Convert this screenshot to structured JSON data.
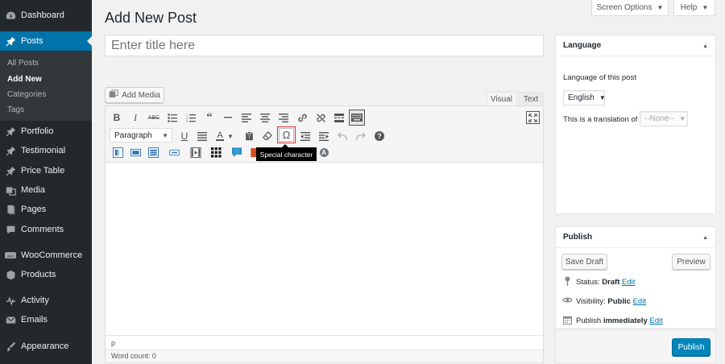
{
  "sidebar": {
    "items": [
      {
        "label": "Dashboard",
        "icon": "dashboard-icon"
      },
      {
        "label": "Posts",
        "icon": "pin-icon",
        "active": true
      },
      {
        "label": "Portfolio",
        "icon": "pin-icon"
      },
      {
        "label": "Testimonial",
        "icon": "pin-icon"
      },
      {
        "label": "Price Table",
        "icon": "pin-icon"
      },
      {
        "label": "Media",
        "icon": "media-icon"
      },
      {
        "label": "Pages",
        "icon": "pages-icon"
      },
      {
        "label": "Comments",
        "icon": "comments-icon"
      },
      {
        "label": "WooCommerce",
        "icon": "woocommerce-icon"
      },
      {
        "label": "Products",
        "icon": "products-icon"
      },
      {
        "label": "Activity",
        "icon": "activity-icon"
      },
      {
        "label": "Emails",
        "icon": "emails-icon"
      },
      {
        "label": "Appearance",
        "icon": "appearance-icon"
      }
    ],
    "submenu": [
      "All Posts",
      "Add New",
      "Categories",
      "Tags"
    ],
    "submenu_current": "Add New"
  },
  "header": {
    "screen_options": "Screen Options",
    "help": "Help",
    "title": "Add New Post"
  },
  "title_field": {
    "placeholder": "Enter title here",
    "value": ""
  },
  "editor": {
    "add_media": "Add Media",
    "tab_visual": "Visual",
    "tab_text": "Text",
    "format_select": "Paragraph",
    "path": "p",
    "word_count": "Word count: 0",
    "tooltip": "Special character"
  },
  "language_box": {
    "title": "Language",
    "subtitle": "Language of this post",
    "language_value": "English",
    "translation_label": "This is a translation of",
    "translation_value": "--None--"
  },
  "publish_box": {
    "title": "Publish",
    "save_draft": "Save Draft",
    "preview": "Preview",
    "status_label": "Status:",
    "status_value": "Draft",
    "visibility_label": "Visibility:",
    "visibility_value": "Public",
    "publish_prefix": "Publish",
    "publish_value": "immediately",
    "edit": "Edit",
    "publish_button": "Publish"
  },
  "colors": {
    "sidebar_bg": "#23282d",
    "active_menu": "#0073aa",
    "primary_button": "#0085ba",
    "highlight_border": "#dc3232"
  }
}
